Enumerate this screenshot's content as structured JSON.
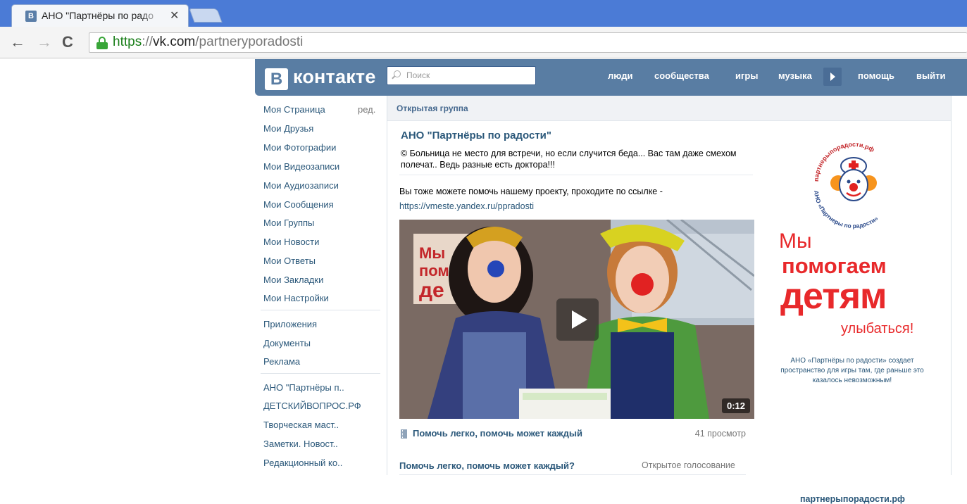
{
  "browser": {
    "tab_icon_letter": "В",
    "tab_title": "АНО \"Партнёры по радо",
    "tab_close": "✕",
    "url_scheme": "https",
    "url_sep": "://",
    "url_host": "vk.com",
    "url_path": "/partneryporadosti"
  },
  "header": {
    "logo_letter": "В",
    "logo_text": "контакте",
    "search_placeholder": "Поиск",
    "nav": [
      "люди",
      "сообщества",
      "игры",
      "музыка",
      "помощь",
      "выйти"
    ]
  },
  "left_menu": {
    "edit_label": "ред.",
    "main": [
      "Моя Страница",
      "Мои Друзья",
      "Мои Фотографии",
      "Мои Видеозаписи",
      "Мои Аудиозаписи",
      "Мои Сообщения",
      "Мои Группы",
      "Мои Новости",
      "Мои Ответы",
      "Мои Закладки",
      "Мои Настройки"
    ],
    "apps": [
      "Приложения",
      "Документы",
      "Реклама"
    ],
    "groups": [
      "АНО \"Партнёры п..",
      "ДЕТСКИЙВОПРОС.РФ",
      "Творческая маст..",
      "Заметки. Новост..",
      "Редакционный ко.."
    ]
  },
  "group": {
    "type_label": "Открытая группа",
    "name": "АНО \"Партнёры по радости\"",
    "status": "© Больница не место для встречи, но если случится беда... Вас там даже смехом полечат.. Ведь разные есть доктора!!!",
    "post_text": "Вы тоже можете помочь нашему проекту, проходите по ссылке -",
    "post_link": "https://vmeste.yandex.ru/ppradosti",
    "video_duration": "0:12",
    "video_title": "Помочь легко, помочь может каждый",
    "video_views": "41 просмотр",
    "poll_question": "Помочь легко, помочь может каждый?",
    "poll_type": "Открытое голосование"
  },
  "banner": {
    "logo_arc_top": "партнерыпорадости.рф",
    "logo_arc_bottom": "АНО «Партнеры по радости»",
    "line1": "Мы",
    "line2": "помогаем",
    "line3": "детям",
    "line4": "улыбаться!",
    "desc": "АНО «Партнёры по радости» создает пространство для игры там, где раньше это казалось невозможным!",
    "site": "партнерыпорадости.рф"
  },
  "colors": {
    "vk_header": "#597da3",
    "vk_link": "#2b587a",
    "banner_red": "#e8292b",
    "chrome_tabbar": "#4b7bd6"
  }
}
